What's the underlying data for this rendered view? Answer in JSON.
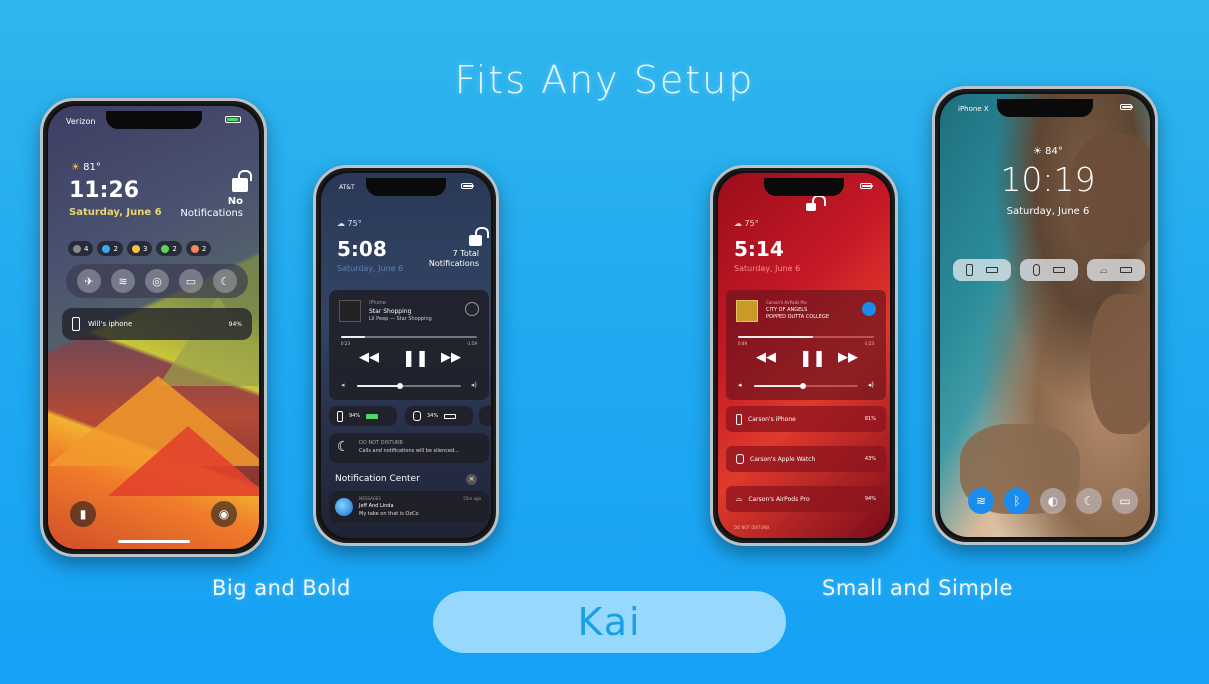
{
  "headline": "Fits Any Setup",
  "captions": {
    "left": "Big and Bold",
    "right": "Small and Simple"
  },
  "kai_button": "Kai",
  "phone1": {
    "carrier": "Verizon",
    "weather": "81°",
    "time": "11:26",
    "date": "Saturday, June 6",
    "notifications_count": "No",
    "notifications_label": "Notifications",
    "status_dots": [
      {
        "count": "4",
        "color": "#8a8a8a"
      },
      {
        "count": "2",
        "color": "#3da9f5"
      },
      {
        "count": "3",
        "color": "#f5c542"
      },
      {
        "count": "2",
        "color": "#5ed35e"
      },
      {
        "count": "2",
        "color": "#f08a5a"
      }
    ],
    "toggles": [
      "airplane-icon",
      "wifi-icon",
      "airdrop-icon",
      "battery-icon",
      "moon-icon"
    ],
    "device_name": "Will's iphone",
    "device_pct": "94%",
    "left_button": "flashlight-icon",
    "right_button": "snapchat-icon"
  },
  "phone2": {
    "carrier": "AT&T",
    "weather": "75°",
    "time": "5:08",
    "date": "Saturday, June 6",
    "notifications_count": "7 Total",
    "notifications_label": "Notifications",
    "media_source": "iPhone",
    "media_title": "Star Shopping",
    "media_artist": "Lil Peep — Star Shopping",
    "elapsed": "0:23",
    "remaining": "-1:59",
    "devices": [
      {
        "pct": "94%"
      },
      {
        "pct": "34%"
      }
    ],
    "dnd_title": "DO NOT DISTURB",
    "dnd_desc": "Calls and notifications will be silenced...",
    "nc_title": "Notification Center",
    "msg_app": "MESSAGES",
    "msg_time": "55m ago",
    "msg_sender": "Jeff And Linda",
    "msg_text": "My take on that is OzCo"
  },
  "phone3": {
    "weather": "75°",
    "time": "5:14",
    "date": "Saturday, June 6",
    "media_source": "Carson's AirPods Pro",
    "media_title": "CITY OF ANGELS",
    "media_artist": "POPPED OUTTA COLLEGE",
    "elapsed": "0:49",
    "remaining": "-1:53",
    "devices": [
      {
        "name": "Carson's iPhone",
        "pct": "81%"
      },
      {
        "name": "Carson's Apple Watch",
        "pct": "43%"
      },
      {
        "name": "Carson's AirPods Pro",
        "pct": "94%"
      }
    ],
    "dnd_title": "DO NOT DISTURB"
  },
  "phone4": {
    "carrier": "iPhone X",
    "weather": "84°",
    "time": "10:19",
    "date": "Saturday, June 6",
    "controls": [
      "wifi-icon",
      "bluetooth-icon",
      "orientation-lock-icon",
      "moon-icon",
      "battery-icon"
    ]
  },
  "colors": {
    "background": "#21aaf0",
    "kai_text": "#1a9fe6",
    "date_yellow": "#e9d86a",
    "accent_blue": "#1a8cf0"
  }
}
